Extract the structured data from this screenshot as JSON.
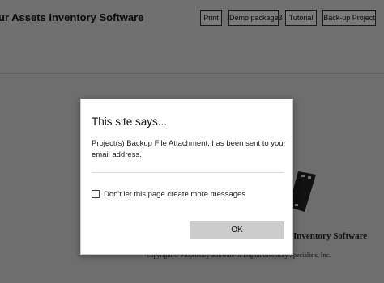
{
  "app": {
    "title": "ur Assets Inventory Software"
  },
  "toolbar": {
    "buttons": [
      {
        "label": "Print"
      },
      {
        "label": "Demo package3"
      },
      {
        "label": "Tutorial"
      },
      {
        "label": "Back-up Project"
      }
    ]
  },
  "background": {
    "product_text": "Inventory Software",
    "copyright_text": "copyright © Proprietary Software of Digital Inventory Specialists, Inc."
  },
  "dialog": {
    "title": "This site says...",
    "message": "Project(s) Backup File Attachment, has been sent to your email address.",
    "checkbox_label": "Don't let this page create more messages",
    "checkbox_checked": false,
    "ok_label": "OK"
  },
  "colors": {
    "overlay_background": "#6e6e6e",
    "dialog_background": "#ffffff",
    "ok_button": "#cccccc"
  }
}
